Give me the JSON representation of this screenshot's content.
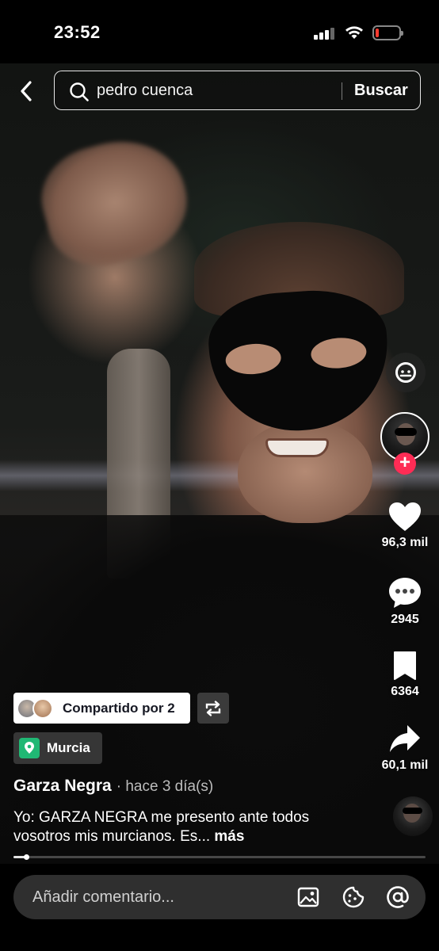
{
  "status_bar": {
    "time": "23:52",
    "battery_level": 0.12,
    "battery_color": "#ff3b30"
  },
  "search": {
    "query": "pedro cuenca",
    "submit_label": "Buscar",
    "icons": [
      "back-arrow-icon",
      "search-icon"
    ]
  },
  "rail": {
    "likes": "96,3 mil",
    "comments": "2945",
    "saves": "6364",
    "shares": "60,1 mil",
    "icons": [
      "mention-icon",
      "heart-icon",
      "comment-bubble-icon",
      "bookmark-icon",
      "share-arrow-icon",
      "plus-icon"
    ]
  },
  "post": {
    "shared_label": "Compartido por 2",
    "location": "Murcia",
    "author": "Garza Negra",
    "time_ago": "· hace 3 día(s)",
    "caption": "Yo: GARZA NEGRA me presento ante todos vosotros mis murcianos. Es...",
    "more_label": "más",
    "progress": 0.03,
    "accent_color": "#fe2c55",
    "location_color": "#20b874"
  },
  "comment_bar": {
    "placeholder": "Añadir comentario...",
    "icons": [
      "image-icon",
      "emoji-icon",
      "at-icon"
    ]
  }
}
